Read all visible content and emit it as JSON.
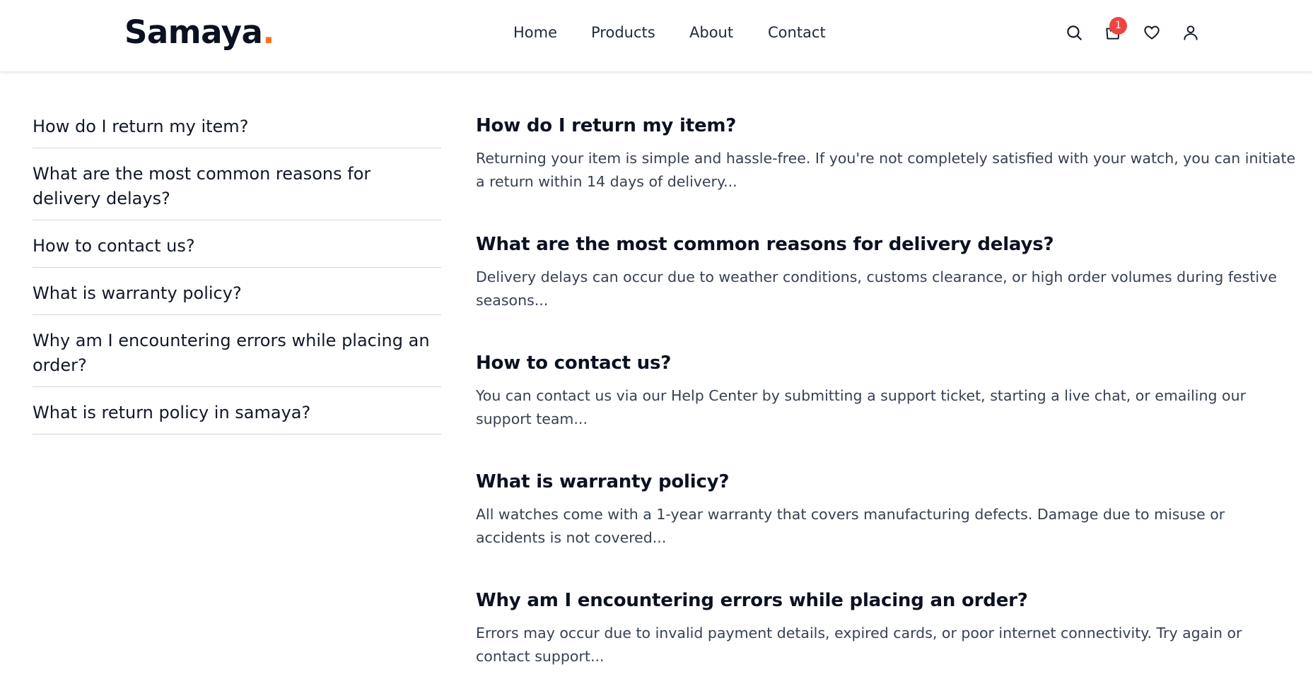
{
  "brand": {
    "name": "Samaya",
    "dot": ".",
    "accent_color": "#f97316"
  },
  "nav": {
    "links": [
      "Home",
      "Products",
      "About",
      "Contact"
    ]
  },
  "header_icons": {
    "search": "search-icon",
    "cart": "shopping-bag-icon",
    "cart_count": "1",
    "wishlist": "heart-icon",
    "account": "user-icon",
    "badge_color": "#ef4444"
  },
  "sidebar": {
    "items": [
      "How do I return my item?",
      "What are the most common reasons for delivery delays?",
      "How to contact us?",
      "What is warranty policy?",
      "Why am I encountering errors while placing an order?",
      "What is return policy in samaya?"
    ]
  },
  "faqs": [
    {
      "question": "How do I return my item?",
      "answer": "Returning your item is simple and hassle-free. If you're not completely satisfied with your watch, you can initiate a return within 14 days of delivery..."
    },
    {
      "question": "What are the most common reasons for delivery delays?",
      "answer": "Delivery delays can occur due to weather conditions, customs clearance, or high order volumes during festive seasons..."
    },
    {
      "question": "How to contact us?",
      "answer": "You can contact us via our Help Center by submitting a support ticket, starting a live chat, or emailing our support team..."
    },
    {
      "question": "What is warranty policy?",
      "answer": "All watches come with a 1-year warranty that covers manufacturing defects. Damage due to misuse or accidents is not covered..."
    },
    {
      "question": "Why am I encountering errors while placing an order?",
      "answer": "Errors may occur due to invalid payment details, expired cards, or poor internet connectivity. Try again or contact support..."
    }
  ]
}
